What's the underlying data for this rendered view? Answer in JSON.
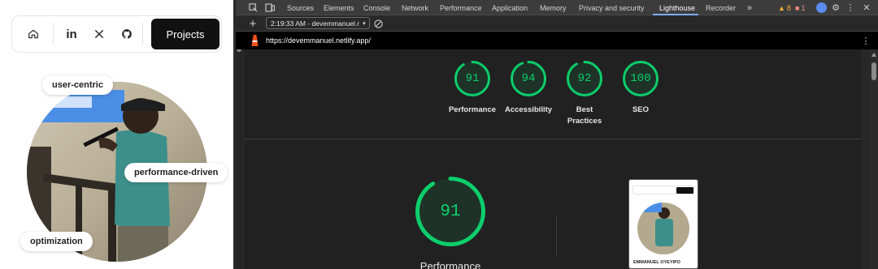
{
  "site": {
    "nav": {
      "home_icon": "home-icon",
      "linkedin_icon": "linkedin-icon",
      "x_icon": "x-icon",
      "github_icon": "github-icon",
      "projects_label": "Projects"
    },
    "tags": {
      "user_centric": "user-centric",
      "performance_driven": "performance-driven",
      "optimization": "optimization"
    }
  },
  "devtools": {
    "tabs": [
      "Sources",
      "Elements",
      "Console",
      "Network",
      "Performance",
      "Application",
      "Memory",
      "Privacy and security",
      "Lighthouse",
      "Recorder"
    ],
    "active_tab": "Lighthouse",
    "more_tabs": "»",
    "warnings_count": "8",
    "errors_count": "1",
    "report_select": "2:19:33 AM - devemmanuel.r",
    "url": "https://devemmanuel.netlify.app/",
    "accent_green": "#0cce6b",
    "scores": [
      {
        "label": "Performance",
        "value": 91
      },
      {
        "label": "Accessibility",
        "value": 94
      },
      {
        "label": "Best Practices",
        "value": 92
      },
      {
        "label": "SEO",
        "value": 100
      }
    ],
    "main_score": {
      "label": "Performance",
      "value": 91
    },
    "thumbnail": {
      "projects_label": "Projects",
      "name_line": "EMMANUEL OYEYIPO"
    }
  }
}
